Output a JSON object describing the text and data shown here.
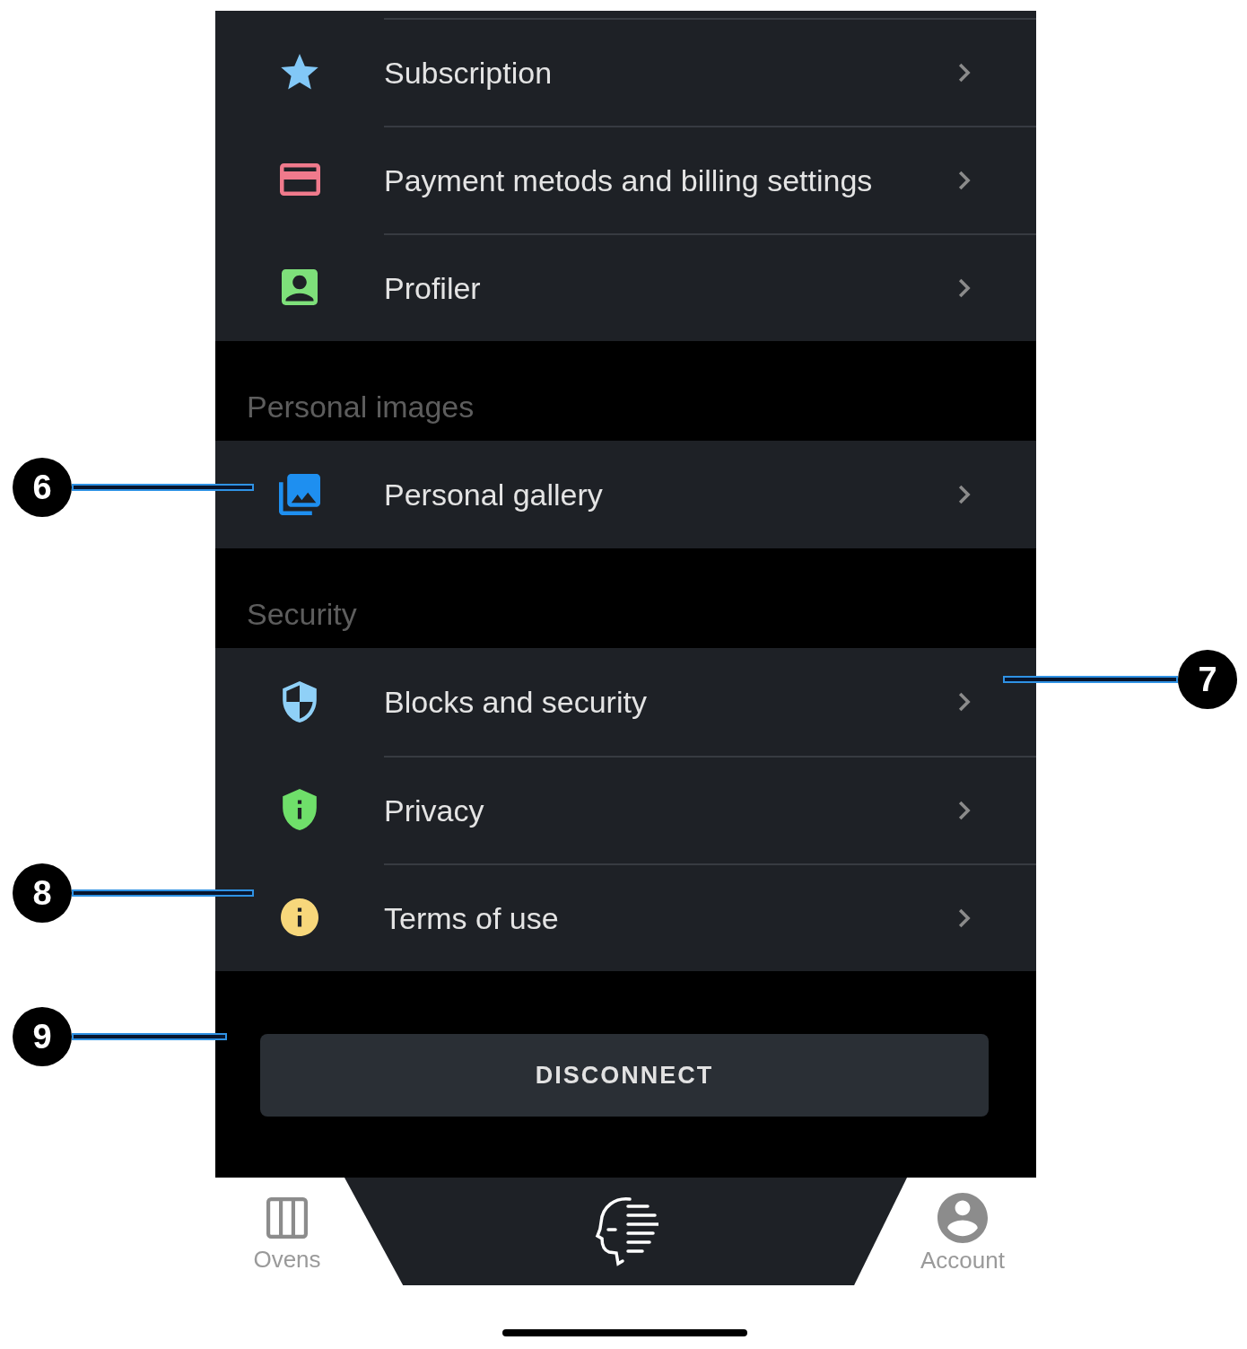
{
  "sections": [
    {
      "items": [
        {
          "label": "Subscription",
          "color": "#82c8f7"
        },
        {
          "label": "Payment metods and billing settings",
          "color": "#f07a8c"
        },
        {
          "label": "Profiler",
          "color": "#7ee07a"
        }
      ]
    },
    {
      "header": "Personal images",
      "items": [
        {
          "label": "Personal gallery",
          "color": "#1e8ff0"
        }
      ]
    },
    {
      "header": "Security",
      "items": [
        {
          "label": "Blocks and security",
          "color": "#8fd0f7"
        },
        {
          "label": "Privacy",
          "color": "#6fdf6a"
        },
        {
          "label": "Terms of use",
          "color": "#f7d77b"
        }
      ]
    }
  ],
  "disconnect_button": {
    "label": "DISCONNECT"
  },
  "bottom_nav": {
    "tabs": [
      {
        "label": "Ovens"
      },
      {
        "label": "Account"
      }
    ]
  },
  "callouts": [
    {
      "number": "6"
    },
    {
      "number": "7"
    },
    {
      "number": "8"
    },
    {
      "number": "9"
    }
  ]
}
